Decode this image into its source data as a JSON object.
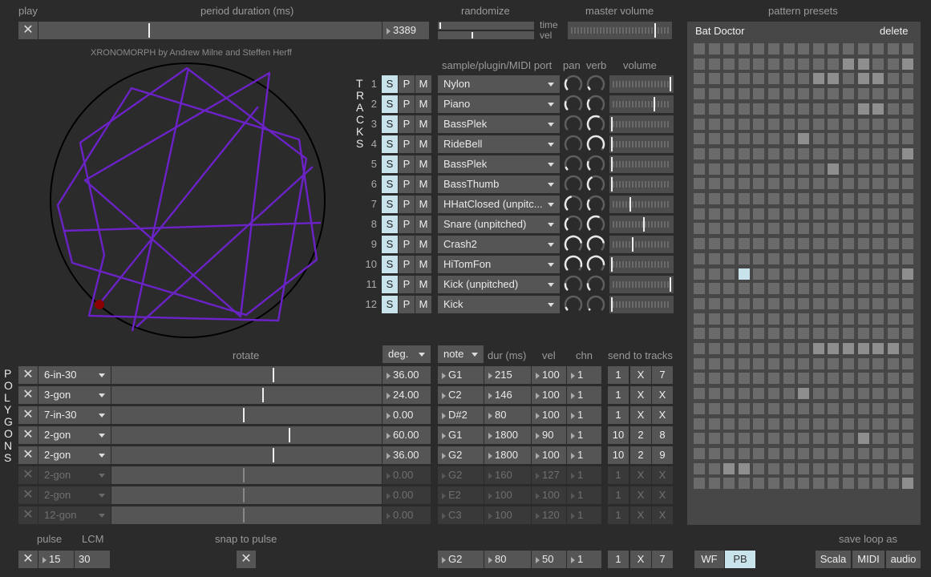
{
  "header": {
    "play": "play",
    "period_label": "period duration (ms)",
    "period_value": "3389",
    "period_fraction": 0.32,
    "randomize": "randomize",
    "time": "time",
    "vel": "vel",
    "master_volume": "master volume",
    "master_volume_level": 0.86,
    "pattern_presets": "pattern presets"
  },
  "circle": {
    "credit": "XRONOMORPH by Andrew Milne and Steffen Herff"
  },
  "tracks": {
    "label_letters": [
      "T",
      "R",
      "A",
      "C",
      "K",
      "S"
    ],
    "sample_header": "sample/plugin/MIDI port",
    "pan_header": "pan",
    "verb_header": "verb",
    "volume_header": "volume",
    "s": "S",
    "p": "P",
    "m": "M",
    "rows": [
      {
        "num": "1",
        "name": "Nylon",
        "pan": 0.3,
        "verb": 0.1,
        "vol": 0.98
      },
      {
        "num": "2",
        "name": "Piano",
        "pan": 0.25,
        "verb": 0.3,
        "vol": 0.72
      },
      {
        "num": "3",
        "name": "BassPlek",
        "pan": 0.0,
        "verb": 0.6,
        "vol": 0.02
      },
      {
        "num": "4",
        "name": "RideBell",
        "pan": 0.0,
        "verb": 0.95,
        "vol": 0.02
      },
      {
        "num": "5",
        "name": "BassPlek",
        "pan": 0.1,
        "verb": 0.25,
        "vol": 0.02
      },
      {
        "num": "6",
        "name": "BassThumb",
        "pan": 0.0,
        "verb": 0.4,
        "vol": 0.02
      },
      {
        "num": "7",
        "name": "HHatClosed (unpitc...",
        "pan": 0.45,
        "verb": 0.3,
        "vol": 0.33
      },
      {
        "num": "8",
        "name": "Snare (unpitched)",
        "pan": 0.35,
        "verb": 0.6,
        "vol": 0.55
      },
      {
        "num": "9",
        "name": "Crash2",
        "pan": 0.8,
        "verb": 0.8,
        "vol": 0.37
      },
      {
        "num": "10",
        "name": "HiTomFon",
        "pan": 0.9,
        "verb": 0.85,
        "vol": 0.02
      },
      {
        "num": "11",
        "name": "Kick (unpitched)",
        "pan": 0.2,
        "verb": 0.2,
        "vol": 0.98
      },
      {
        "num": "12",
        "name": "Kick",
        "pan": 0.1,
        "verb": 0.05,
        "vol": 0.02
      }
    ]
  },
  "polygons": {
    "label_letters": [
      "P",
      "O",
      "L",
      "Y",
      "G",
      "O",
      "N",
      "S"
    ],
    "rotate_header": "rotate",
    "deg_label": "deg.",
    "note_label": "note",
    "dur_header": "dur (ms)",
    "vel_header": "vel",
    "chn_header": "chn",
    "send_header": "send to tracks",
    "rows": [
      {
        "name": "6-in-30",
        "rot": 0.6,
        "deg": "36.00",
        "note": "G1",
        "dur": "215",
        "vel": "100",
        "chn": "1",
        "s1": "1",
        "s2": "X",
        "s3": "7",
        "active": true
      },
      {
        "name": "3-gon",
        "rot": 0.56,
        "deg": "24.00",
        "note": "C2",
        "dur": "146",
        "vel": "100",
        "chn": "1",
        "s1": "1",
        "s2": "X",
        "s3": "X",
        "active": true
      },
      {
        "name": "7-in-30",
        "rot": 0.49,
        "deg": "0.00",
        "note": "D#2",
        "dur": "80",
        "vel": "100",
        "chn": "1",
        "s1": "1",
        "s2": "X",
        "s3": "X",
        "active": true
      },
      {
        "name": "2-gon",
        "rot": 0.66,
        "deg": "60.00",
        "note": "G1",
        "dur": "1800",
        "vel": "90",
        "chn": "1",
        "s1": "10",
        "s2": "2",
        "s3": "8",
        "active": true
      },
      {
        "name": "2-gon",
        "rot": 0.6,
        "deg": "36.00",
        "note": "G2",
        "dur": "1800",
        "vel": "100",
        "chn": "1",
        "s1": "10",
        "s2": "2",
        "s3": "9",
        "active": true
      },
      {
        "name": "2-gon",
        "rot": 0.49,
        "deg": "0.00",
        "note": "G2",
        "dur": "160",
        "vel": "127",
        "chn": "1",
        "s1": "1",
        "s2": "X",
        "s3": "X",
        "active": false
      },
      {
        "name": "2-gon",
        "rot": 0.49,
        "deg": "0.00",
        "note": "E2",
        "dur": "100",
        "vel": "100",
        "chn": "1",
        "s1": "1",
        "s2": "X",
        "s3": "X",
        "active": false
      },
      {
        "name": "12-gon",
        "rot": 0.49,
        "deg": "0.00",
        "note": "C3",
        "dur": "100",
        "vel": "120",
        "chn": "1",
        "s1": "1",
        "s2": "X",
        "s3": "X",
        "active": false
      }
    ]
  },
  "footer": {
    "pulse": "pulse",
    "lcm": "LCM",
    "pulse_value": "15",
    "lcm_value": "30",
    "snap": "snap to pulse",
    "note": "G2",
    "dur": "80",
    "vel": "50",
    "chn": "1",
    "s1": "1",
    "s2": "X",
    "s3": "7",
    "save_loop": "save loop as",
    "wf": "WF",
    "pb": "PB",
    "scala": "Scala",
    "midi": "MIDI",
    "audio": "audio"
  },
  "presets": {
    "name": "Bat Doctor",
    "delete": "delete",
    "rows": [
      "bbbbbbbbbbbbbbb",
      "bbbbbbbbbbllbbl",
      "bbbbbbbbllbllbb",
      "bbbbbbbbbbbbbbb",
      "bbbbbbbbbbbllbb",
      "bbbbbbbbbbbbbbb",
      "bbbbbbblbbbbbbb",
      "bbbbbbbbbbbbbbl",
      "bbbbbbbbblbbbbb",
      "bbbbbbbbbbbbbbb",
      "bbbbbbbbbbbbbbb",
      "bbbbbbbbbbbbbbb",
      "bbbbbbbbbbbbbbb",
      "bbbbbbbbbbbbbbb",
      "bbbbbbbbbbbbbbb",
      "bbbwbbbbbbbbbbl",
      "bbbbbbbbbbbbbbb",
      "bbbbbbbbbbbbbbb",
      "bbbbbbbbbbbbbbb",
      "bbbbbbbbbbbbbbb",
      "bbbbbbbbllllllb",
      "bbbbbbbbbbbbbbb",
      "bbbbbbbbbbbbbbb",
      "bbbbbbblbbbbbbb",
      "bbbbbbbbbbbbbbb",
      "bbbbbbbbbbbbbbb",
      "bbbbbbbbbbblbbb",
      "bbbbbbbbbbbbbbb",
      "bbllbbbbbbbbbbb",
      "bbbbbbbbbbbbbbl"
    ]
  },
  "colors": {
    "accent": "#c9e3ec",
    "polygon": "#6b22c6",
    "dot": "#8b0000"
  }
}
